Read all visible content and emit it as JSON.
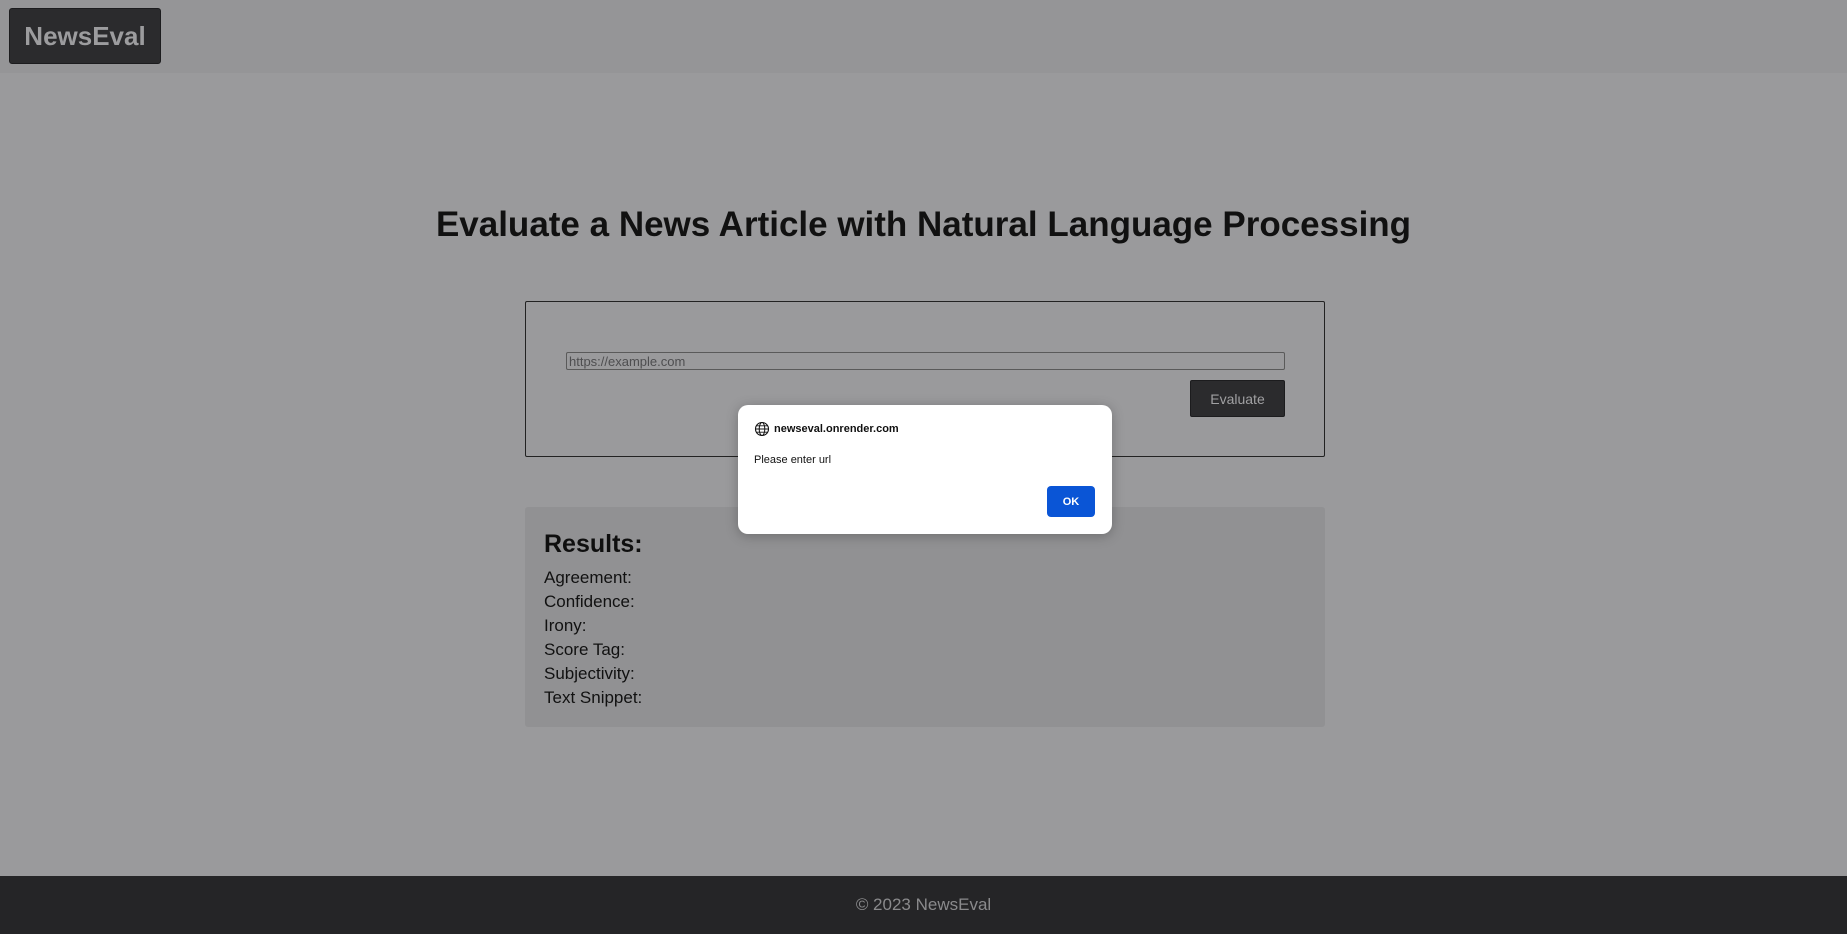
{
  "header": {
    "brand": "NewsEval"
  },
  "main": {
    "title": "Evaluate a News Article with Natural Language Processing",
    "form": {
      "url_placeholder": "https://example.com",
      "url_value": "",
      "submit_label": "Evaluate"
    },
    "results": {
      "heading": "Results:",
      "fields": [
        "Agreement:",
        "Confidence:",
        "Irony:",
        "Score Tag:",
        "Subjectivity:",
        "Text Snippet:"
      ]
    }
  },
  "footer": {
    "text": "© 2023 NewsEval"
  },
  "alert_dialog": {
    "host": "newseval.onrender.com",
    "message": "Please enter url",
    "ok_label": "OK",
    "icon": "globe-icon"
  },
  "colors": {
    "page_overlay": "#9a9a9c",
    "dark": "#2b2b2d",
    "footer_bg": "#252527",
    "ok_button": "#0a55d6"
  }
}
